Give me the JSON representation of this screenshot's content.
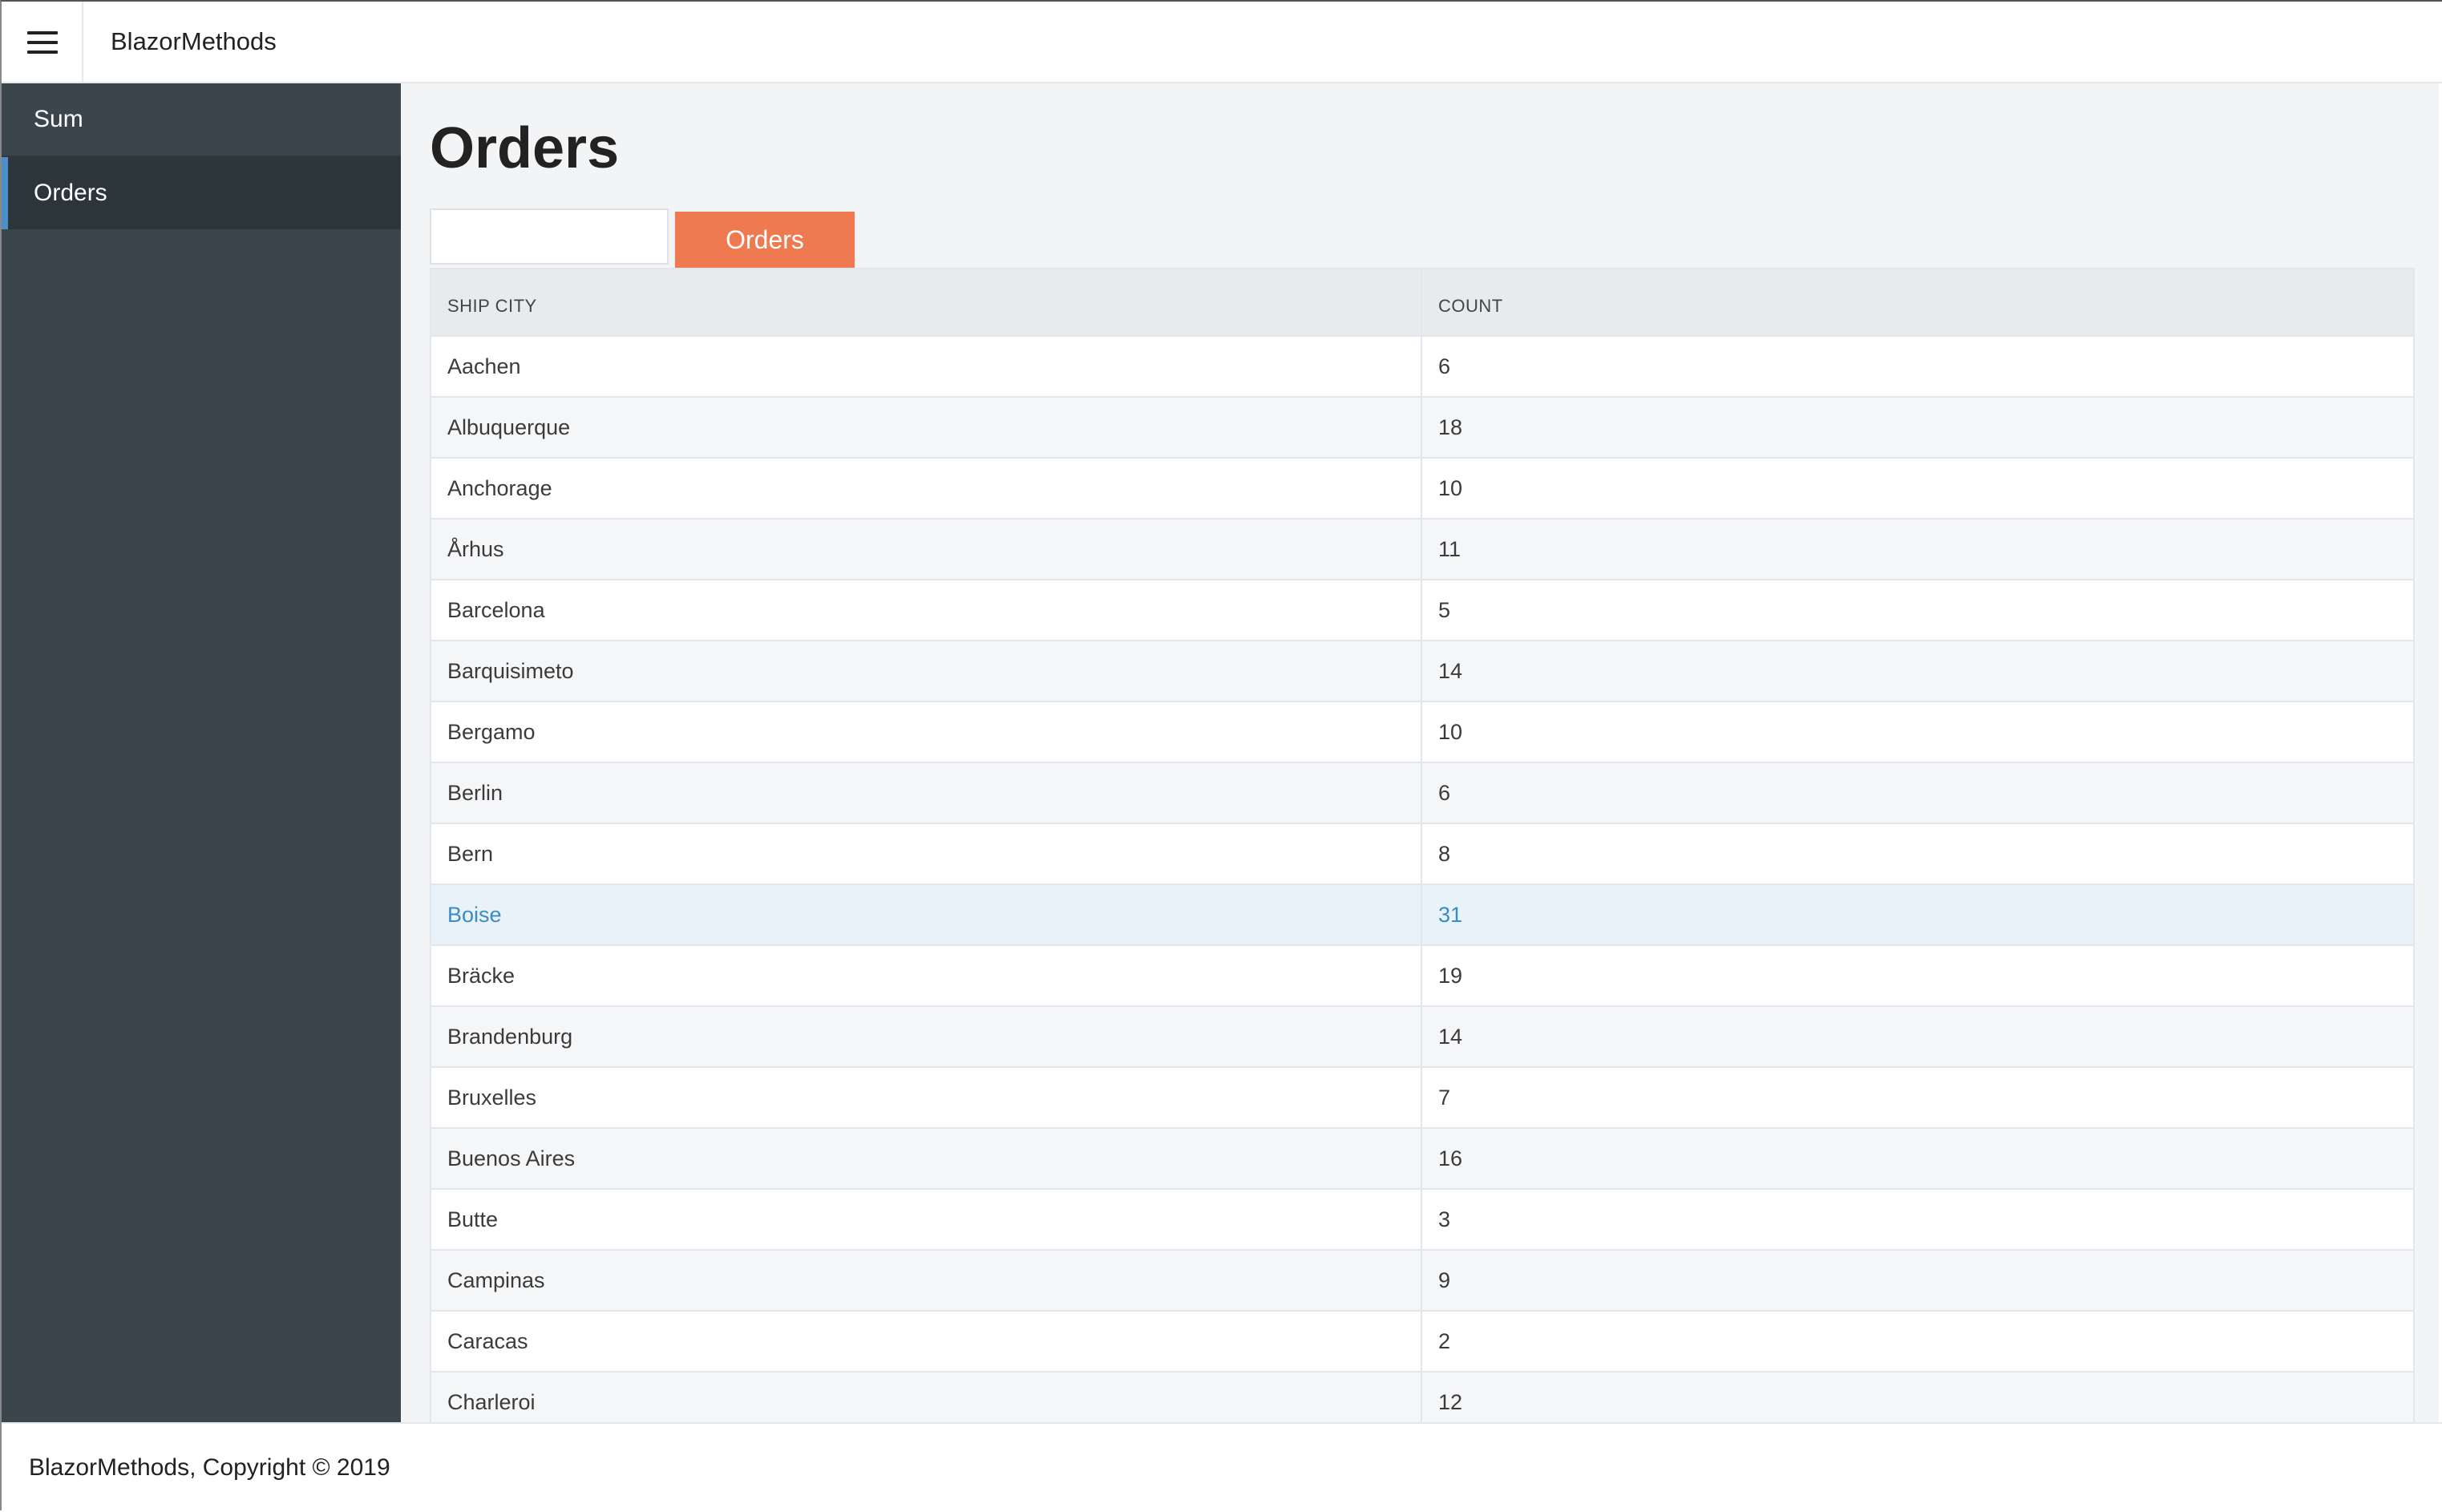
{
  "app": {
    "brand": "BlazorMethods",
    "menu_icon": "hamburger-menu-icon"
  },
  "sidebar": {
    "items": [
      {
        "label": "Sum",
        "active": false
      },
      {
        "label": "Orders",
        "active": true
      }
    ]
  },
  "page": {
    "title": "Orders",
    "search_value": "",
    "search_placeholder": "",
    "button_label": "Orders",
    "button_color": "#f07a4f"
  },
  "grid": {
    "headers": [
      "SHIP CITY",
      "COUNT"
    ],
    "rows": [
      {
        "city": "Aachen",
        "count": "6"
      },
      {
        "city": "Albuquerque",
        "count": "18"
      },
      {
        "city": "Anchorage",
        "count": "10"
      },
      {
        "city": "Århus",
        "count": "11"
      },
      {
        "city": "Barcelona",
        "count": "5"
      },
      {
        "city": "Barquisimeto",
        "count": "14"
      },
      {
        "city": "Bergamo",
        "count": "10"
      },
      {
        "city": "Berlin",
        "count": "6"
      },
      {
        "city": "Bern",
        "count": "8"
      },
      {
        "city": "Boise",
        "count": "31"
      },
      {
        "city": "Bräcke",
        "count": "19"
      },
      {
        "city": "Brandenburg",
        "count": "14"
      },
      {
        "city": "Bruxelles",
        "count": "7"
      },
      {
        "city": "Buenos Aires",
        "count": "16"
      },
      {
        "city": "Butte",
        "count": "3"
      },
      {
        "city": "Campinas",
        "count": "9"
      },
      {
        "city": "Caracas",
        "count": "2"
      },
      {
        "city": "Charleroi",
        "count": "12"
      }
    ],
    "hovered_row": 9
  },
  "footer": {
    "text": "BlazorMethods, Copyright © 2019"
  },
  "colors": {
    "sidebar_bg": "#3a464b",
    "sidebar_active_bg": "#2c353a",
    "sidebar_active_accent": "#4c8ec5",
    "main_bg": "#f3f4f6",
    "hover_text": "#3a8cc1"
  }
}
